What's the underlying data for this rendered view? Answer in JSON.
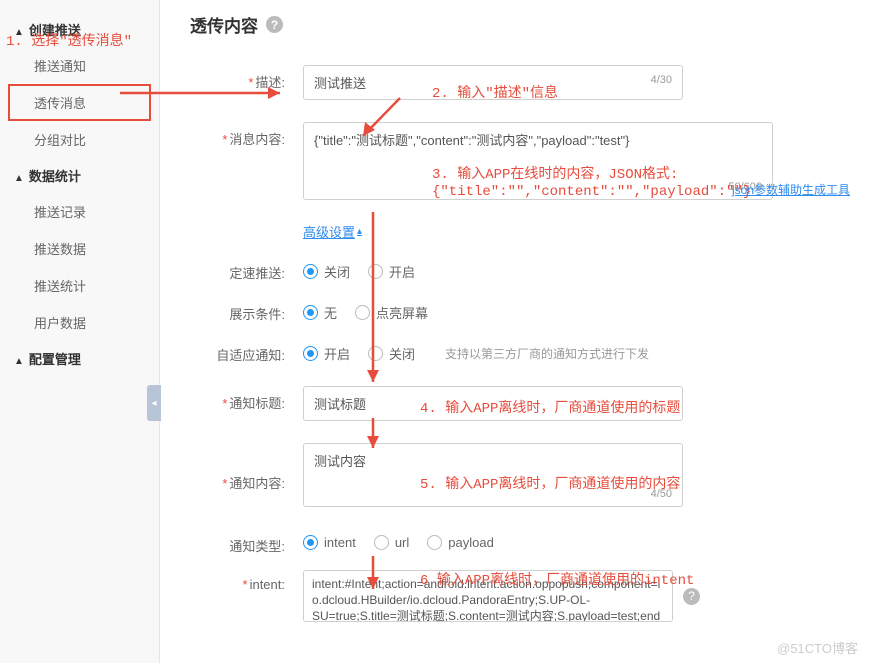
{
  "sidebar": {
    "group1": "创建推送",
    "items1": [
      "推送通知",
      "透传消息",
      "分组对比"
    ],
    "group2": "数据统计",
    "items2": [
      "推送记录",
      "推送数据",
      "推送统计",
      "用户数据"
    ],
    "group3": "配置管理"
  },
  "page": {
    "title": "透传内容"
  },
  "form": {
    "desc_label": "描述:",
    "desc_value": "测试推送",
    "desc_counter": "4/30",
    "msg_label": "消息内容:",
    "msg_value": "{\"title\":\"测试标题\",\"content\":\"测试内容\",\"payload\":\"test\"}",
    "msg_counter": "50/600",
    "json_tool": "json参数辅助生成工具",
    "adv": "高级设置",
    "speed_label": "定速推送:",
    "speed_opts": [
      "关闭",
      "开启"
    ],
    "cond_label": "展示条件:",
    "cond_opts": [
      "无",
      "点亮屏幕"
    ],
    "adapt_label": "自适应通知:",
    "adapt_opts": [
      "开启",
      "关闭"
    ],
    "adapt_hint": "支持以第三方厂商的通知方式进行下发",
    "ntitle_label": "通知标题:",
    "ntitle_value": "测试标题",
    "ncontent_label": "通知内容:",
    "ncontent_value": "测试内容",
    "ncontent_counter": "4/50",
    "ntype_label": "通知类型:",
    "ntype_opts": [
      "intent",
      "url",
      "payload"
    ],
    "intent_label": "intent:",
    "intent_value": "intent:#Intent;action=android.intent.action.oppopush;component=io.dcloud.HBuilder/io.dcloud.PandoraEntry;S.UP-OL-SU=true;S.title=测试标题;S.content=测试内容;S.payload=test;end"
  },
  "anno": {
    "a1": "1. 选择\"透传消息\"",
    "a2": "2. 输入\"描述\"信息",
    "a3a": "3. 输入APP在线时的内容，JSON格式:",
    "a3b": "{\"title\":\"\",\"content\":\"\",\"payload\":\"\"}",
    "a4": "4. 输入APP离线时，厂商通道使用的标题",
    "a5": "5. 输入APP离线时，厂商通道使用的内容",
    "a6": "6 输入APP离线时，厂商通道使用的intent"
  },
  "watermark": "@51CTO博客"
}
